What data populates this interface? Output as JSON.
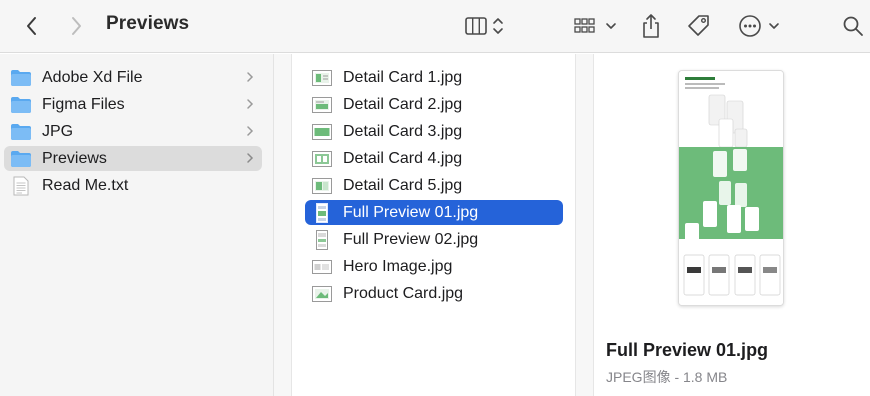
{
  "window": {
    "title": "Previews"
  },
  "toolbar": {
    "back_icon": "chevron-left",
    "forward_icon": "chevron-right",
    "view_icon": "columns-view",
    "group_icon": "grid-group",
    "share_icon": "share",
    "tag_icon": "tag",
    "more_icon": "ellipsis-circle",
    "search_icon": "magnifying-glass"
  },
  "sidebar_column": {
    "items": [
      {
        "label": "Adobe Xd File",
        "icon": "folder-icon",
        "has_children": true
      },
      {
        "label": "Figma Files",
        "icon": "folder-icon",
        "has_children": true
      },
      {
        "label": "JPG",
        "icon": "folder-icon",
        "has_children": true
      },
      {
        "label": "Previews",
        "icon": "folder-icon",
        "has_children": true,
        "selected": true
      },
      {
        "label": "Read Me.txt",
        "icon": "text-file-icon",
        "has_children": false
      }
    ]
  },
  "file_column": {
    "items": [
      {
        "label": "Detail Card 1.jpg",
        "icon": "jpg-thumbnail-icon"
      },
      {
        "label": "Detail Card 2.jpg",
        "icon": "jpg-thumbnail-icon"
      },
      {
        "label": "Detail Card 3.jpg",
        "icon": "jpg-thumbnail-icon"
      },
      {
        "label": "Detail Card 4.jpg",
        "icon": "jpg-thumbnail-icon"
      },
      {
        "label": "Detail Card 5.jpg",
        "icon": "jpg-thumbnail-icon"
      },
      {
        "label": "Full Preview 01.jpg",
        "icon": "jpg-thumbnail-icon",
        "selected": true
      },
      {
        "label": "Full Preview 02.jpg",
        "icon": "jpg-thumbnail-icon"
      },
      {
        "label": "Hero Image.jpg",
        "icon": "jpg-thumbnail-icon"
      },
      {
        "label": "Product Card.jpg",
        "icon": "jpg-thumbnail-icon"
      }
    ]
  },
  "preview": {
    "name": "Full Preview 01.jpg",
    "meta": "JPEG图像 - 1.8 MB"
  },
  "colors": {
    "selection_blue": "#2563d9",
    "folder_blue": "#5aa9f0",
    "thumb_green": "#6dbb7a"
  }
}
